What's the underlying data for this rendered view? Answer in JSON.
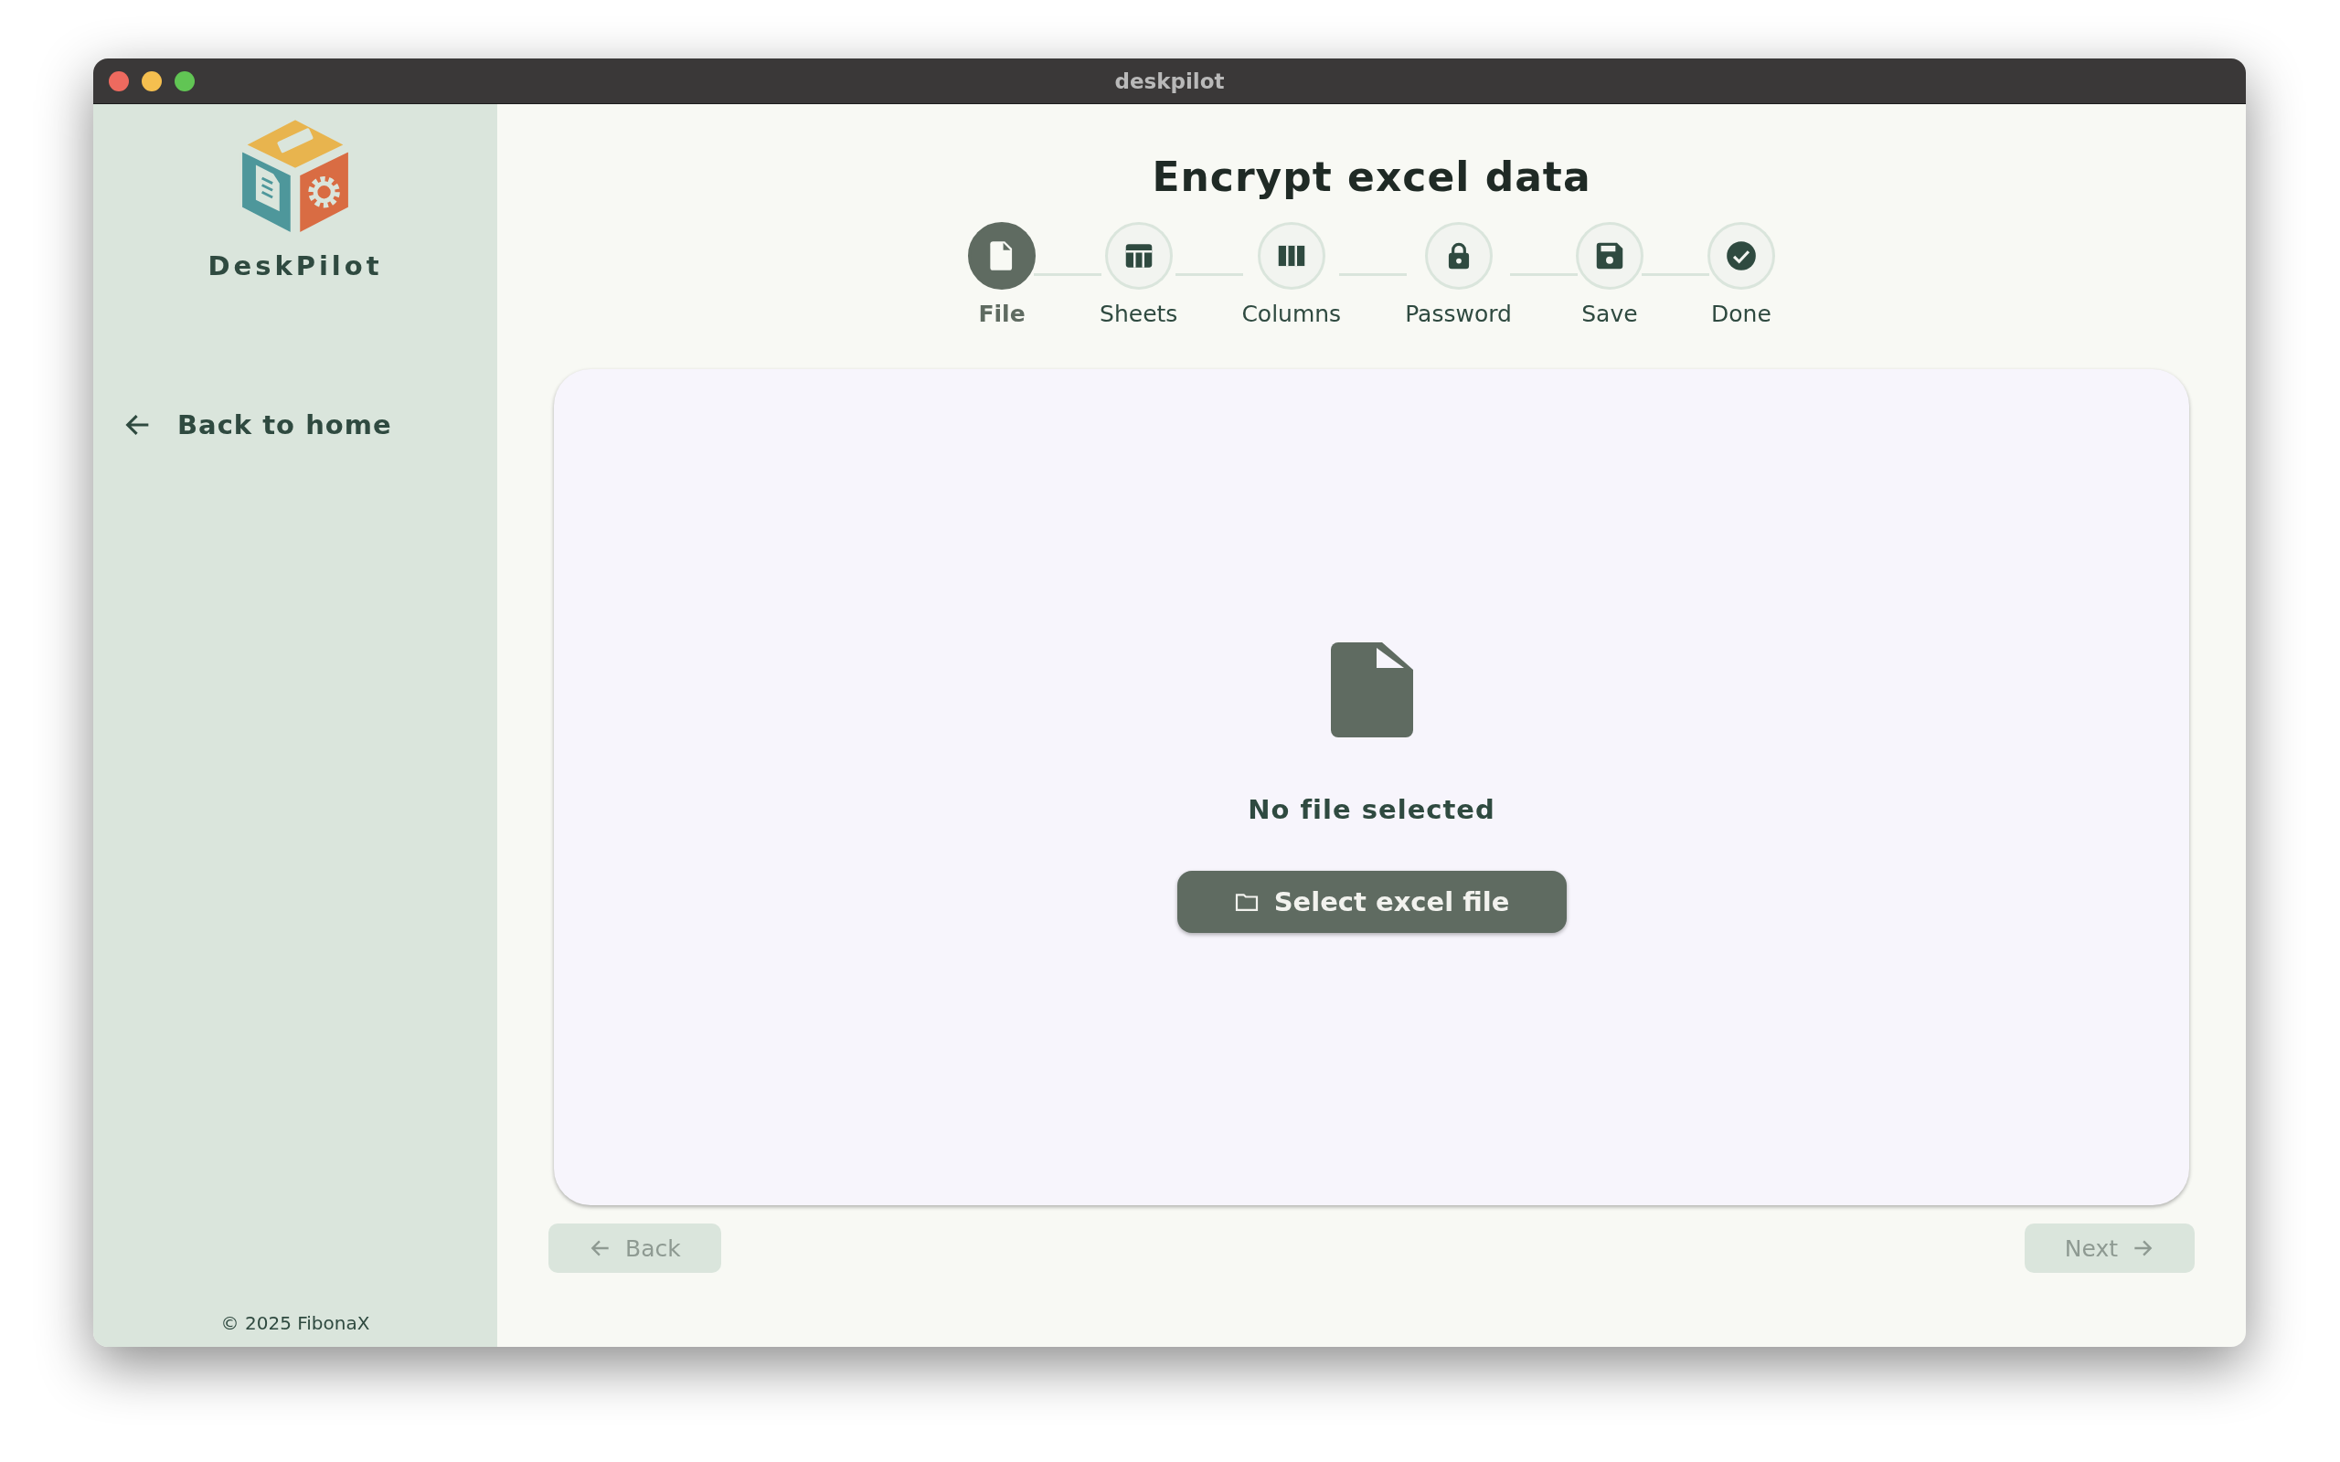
{
  "window": {
    "title": "deskpilot"
  },
  "sidebar": {
    "app_name": "DeskPilot",
    "back_link": "Back to home",
    "footer": "© 2025 FibonaX"
  },
  "page": {
    "title": "Encrypt excel data"
  },
  "steps": [
    {
      "label": "File",
      "kind": "file",
      "selected": true
    },
    {
      "label": "Sheets",
      "kind": "table",
      "selected": false
    },
    {
      "label": "Columns",
      "kind": "columns",
      "selected": false
    },
    {
      "label": "Password",
      "kind": "lock",
      "selected": false
    },
    {
      "label": "Save",
      "kind": "save",
      "selected": false
    },
    {
      "label": "Done",
      "kind": "check",
      "selected": false
    }
  ],
  "panel": {
    "message": "No file selected",
    "button": "Select excel file"
  },
  "nav": [
    {
      "label": "Back",
      "kind": "back",
      "disabled": true
    },
    {
      "label": "Next",
      "kind": "next",
      "disabled": true
    }
  ]
}
